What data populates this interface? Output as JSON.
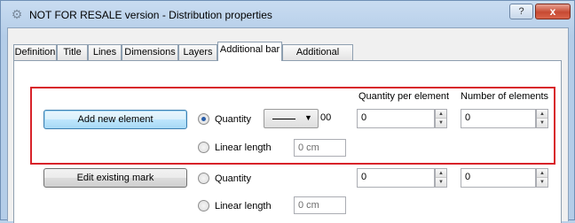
{
  "window": {
    "title": "NOT FOR RESALE version - Distribution properties",
    "help_label": "?",
    "close_label": "x",
    "app_icon": "gear-icon"
  },
  "tabs": [
    {
      "label": "Definition",
      "active": false
    },
    {
      "label": "Title",
      "active": false
    },
    {
      "label": "Lines",
      "active": false
    },
    {
      "label": "Dimensions",
      "active": false
    },
    {
      "label": "Layers",
      "active": false
    },
    {
      "label": "Additional bar",
      "active": true
    },
    {
      "label": "Additional mesh",
      "active": false
    }
  ],
  "columns": {
    "quantity_per_element": "Quantity per element",
    "number_of_elements": "Number of elements"
  },
  "new_element": {
    "button_label": "Add new element",
    "quantity_label": "Quantity",
    "quantity_selected": true,
    "line_combo_text": "00",
    "linear_length_label": "Linear length",
    "linear_length_value": "0 cm",
    "quantity_per_element": "0",
    "number_of_elements": "0"
  },
  "existing_mark": {
    "button_label": "Edit existing mark",
    "quantity_label": "Quantity",
    "linear_length_label": "Linear length",
    "linear_length_value": "0 cm",
    "quantity_per_element": "0",
    "number_of_elements": "0"
  }
}
